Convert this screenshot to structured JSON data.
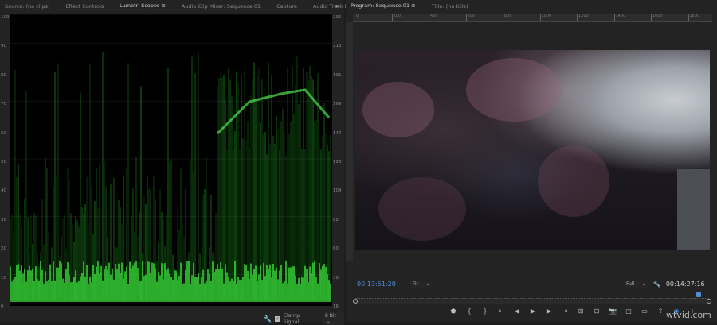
{
  "left_panel": {
    "tabs": [
      "Source: (no clips)",
      "Effect Controls",
      "Lumetri Scopes",
      "Audio Clip Mixer: Sequence 01",
      "Capture",
      "Audio Track Mixer: Se"
    ],
    "active_tab": "Lumetri Scopes",
    "overflow": "»",
    "left_axis": [
      "100",
      "90",
      "80",
      "70",
      "60",
      "50",
      "40",
      "30",
      "20",
      "10",
      "0"
    ],
    "right_axis": [
      "235",
      "213",
      "191",
      "169",
      "147",
      "126",
      "104",
      "82",
      "60",
      "38",
      "16"
    ],
    "clamp_signal_label": "Clamp Signal",
    "clamp_signal_checked": true,
    "bit_depth": "8 Bit"
  },
  "right_panel": {
    "tabs": [
      "Program: Sequence 01",
      "Title: (no title)"
    ],
    "active_tab": "Program: Sequence 01",
    "ruler": [
      "0",
      "200",
      "400",
      "600",
      "800",
      "1000",
      "1200",
      "1400",
      "1600",
      "1800"
    ],
    "current_timecode": "00:13:51:20",
    "zoom": "Fit",
    "resolution": "Full",
    "duration": "00:14:27:16",
    "playhead_fraction": 0.97,
    "watermark": "wtvid.com"
  },
  "accent": "#4f8fd6"
}
